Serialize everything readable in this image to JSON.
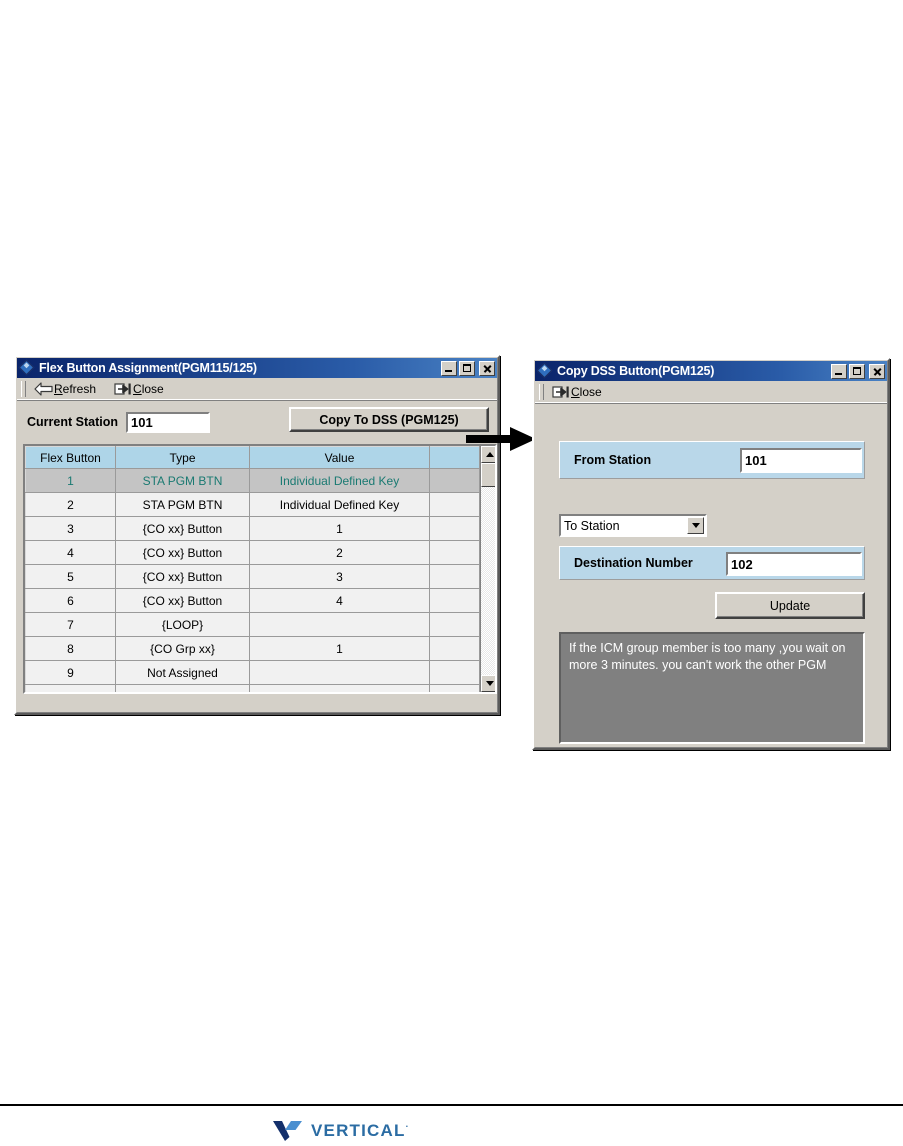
{
  "flex_window": {
    "title": "Flex Button Assignment(PGM115/125)",
    "title_icon": "app-diamond-icon",
    "window_controls": {
      "minimize": "minimize-icon",
      "maximize": "maximize-icon",
      "close": "close-icon"
    },
    "toolbar": {
      "refresh": {
        "mnemonic": "R",
        "rest": "efresh",
        "icon": "left-arrow-icon"
      },
      "close": {
        "mnemonic": "C",
        "rest": "lose",
        "icon": "exit-door-icon"
      }
    },
    "current_station": {
      "label": "Current Station",
      "value": "101"
    },
    "copy_button": "Copy To DSS (PGM125)",
    "grid": {
      "columns": [
        "Flex Button",
        "Type",
        "Value"
      ],
      "rows": [
        {
          "button": "1",
          "type": "STA PGM BTN",
          "value": "Individual Defined Key",
          "selected": true
        },
        {
          "button": "2",
          "type": "STA PGM BTN",
          "value": "Individual Defined Key",
          "selected": false
        },
        {
          "button": "3",
          "type": "{CO xx} Button",
          "value": "1",
          "selected": false
        },
        {
          "button": "4",
          "type": "{CO xx} Button",
          "value": "2",
          "selected": false
        },
        {
          "button": "5",
          "type": "{CO xx} Button",
          "value": "3",
          "selected": false
        },
        {
          "button": "6",
          "type": "{CO xx} Button",
          "value": "4",
          "selected": false
        },
        {
          "button": "7",
          "type": "{LOOP}",
          "value": "",
          "selected": false
        },
        {
          "button": "8",
          "type": "{CO Grp xx}",
          "value": "1",
          "selected": false
        },
        {
          "button": "9",
          "type": "Not Assigned",
          "value": "",
          "selected": false
        },
        {
          "button": "",
          "type": "",
          "value": "",
          "selected": false
        }
      ]
    },
    "scrollbar": {
      "up": "scroll-up-icon",
      "down": "scroll-down-icon"
    }
  },
  "copy_window": {
    "title": "Copy DSS Button(PGM125)",
    "title_icon": "app-diamond-icon",
    "window_controls": {
      "minimize": "minimize-icon",
      "maximize": "maximize-icon",
      "close": "close-icon"
    },
    "toolbar": {
      "close": {
        "mnemonic": "C",
        "rest": "lose",
        "icon": "exit-door-icon"
      }
    },
    "from_station": {
      "label": "From Station",
      "value": "101"
    },
    "to_select": {
      "selected": "To Station",
      "options": [
        "To Station"
      ]
    },
    "destination": {
      "label": "Destination Number",
      "value": "102"
    },
    "update_button": "Update",
    "message": "If the ICM group member is too many ,you wait on more 3 minutes. you can't work the other PGM"
  },
  "connector": {
    "name": "flow-arrow"
  },
  "footer": {
    "logo_text": "VERTICAL",
    "logo_tm": "·",
    "logo_mark": "vertical-v-logo-icon"
  },
  "colors": {
    "titlebar_start": "#0a246a",
    "titlebar_end": "#4a82c4",
    "chrome": "#d4d0c8",
    "grid_header": "#aed5e8",
    "band": "#b9d7e9",
    "selected_row_bg": "#c4c4c4",
    "selected_row_text": "#1a7a72",
    "message_bg": "#808080",
    "brand": "#2b6ca3"
  }
}
